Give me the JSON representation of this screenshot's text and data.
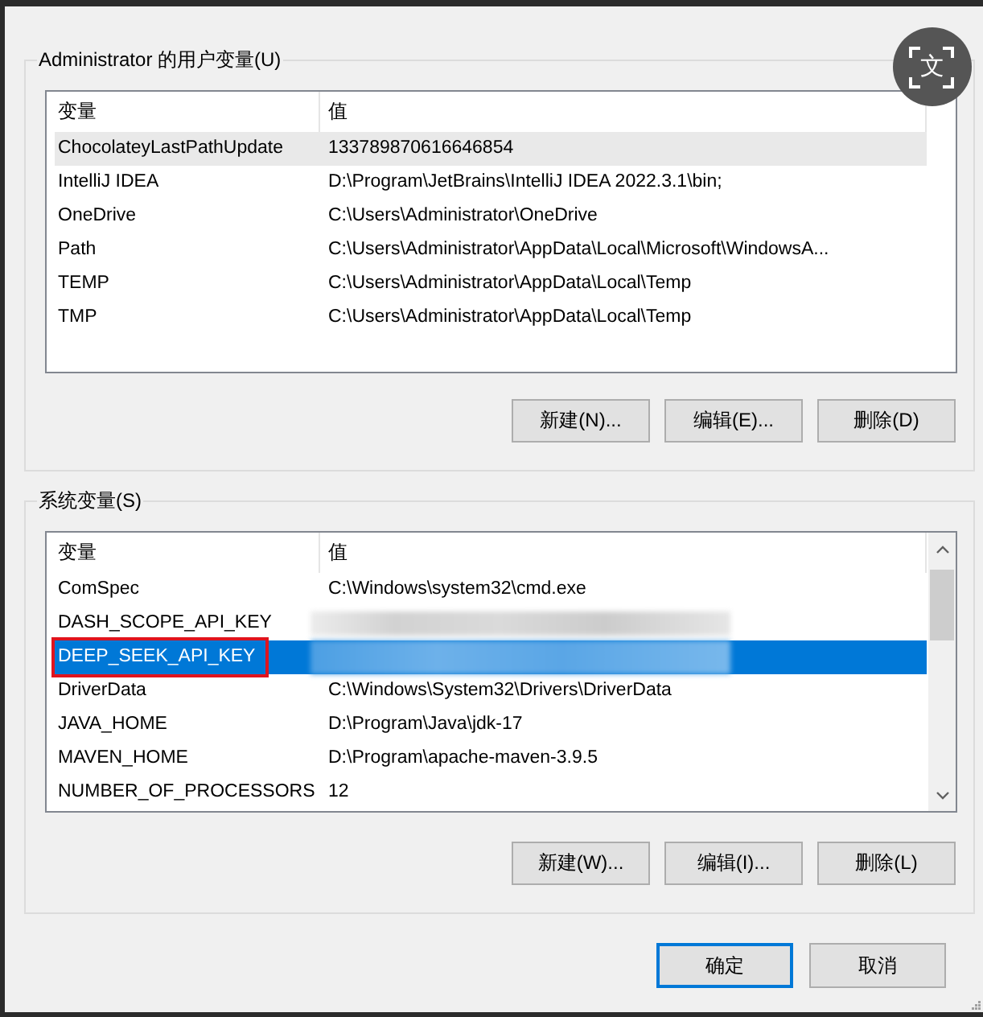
{
  "translate_button": {
    "label": "文"
  },
  "user_variables": {
    "title": "Administrator 的用户变量(U)",
    "focused": false,
    "columns": [
      "变量",
      "值"
    ],
    "rows": [
      {
        "name": "ChocolateyLastPathUpdate",
        "value": "133789870616646854",
        "selected": true
      },
      {
        "name": "IntelliJ IDEA",
        "value": "D:\\Program\\JetBrains\\IntelliJ IDEA 2022.3.1\\bin;",
        "selected": false
      },
      {
        "name": "OneDrive",
        "value": "C:\\Users\\Administrator\\OneDrive",
        "selected": false
      },
      {
        "name": "Path",
        "value": "C:\\Users\\Administrator\\AppData\\Local\\Microsoft\\WindowsA...",
        "selected": false
      },
      {
        "name": "TEMP",
        "value": "C:\\Users\\Administrator\\AppData\\Local\\Temp",
        "selected": false
      },
      {
        "name": "TMP",
        "value": "C:\\Users\\Administrator\\AppData\\Local\\Temp",
        "selected": false
      }
    ],
    "buttons": [
      "新建(N)...",
      "编辑(E)...",
      "删除(D)"
    ]
  },
  "system_variables": {
    "title": "系统变量(S)",
    "focused": true,
    "scrollbar": true,
    "columns": [
      "变量",
      "值"
    ],
    "rows": [
      {
        "name": "ComSpec",
        "value": "C:\\Windows\\system32\\cmd.exe",
        "redacted": false,
        "annotated": false,
        "selected": false
      },
      {
        "name": "DASH_SCOPE_API_KEY",
        "redacted": true,
        "annotated": false,
        "selected": false
      },
      {
        "name": "DEEP_SEEK_API_KEY",
        "redacted": true,
        "annotated": true,
        "selected": true
      },
      {
        "name": "DriverData",
        "value": "C:\\Windows\\System32\\Drivers\\DriverData",
        "redacted": false,
        "annotated": false,
        "selected": false
      },
      {
        "name": "JAVA_HOME",
        "value": "D:\\Program\\Java\\jdk-17",
        "redacted": false,
        "annotated": false,
        "selected": false
      },
      {
        "name": "MAVEN_HOME",
        "value": "D:\\Program\\apache-maven-3.9.5",
        "redacted": false,
        "annotated": false,
        "selected": false
      },
      {
        "name": "NUMBER_OF_PROCESSORS",
        "value": "12",
        "redacted": false,
        "annotated": false,
        "selected": false
      }
    ],
    "buttons": [
      "新建(W)...",
      "编辑(I)...",
      "删除(L)"
    ]
  },
  "dialog_buttons": [
    {
      "label": "确定",
      "default": true
    },
    {
      "label": "取消",
      "default": false
    }
  ]
}
